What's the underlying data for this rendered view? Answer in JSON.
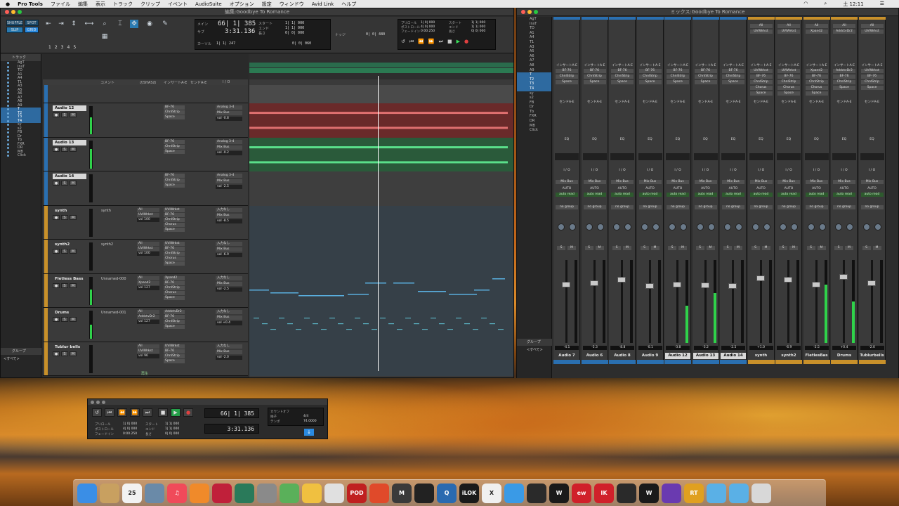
{
  "menubar": {
    "items": [
      "Pro Tools",
      "ファイル",
      "編集",
      "表示",
      "トラック",
      "クリップ",
      "イベント",
      "AudioSuite",
      "オプション",
      "設定",
      "ウィンドウ",
      "Avid Link",
      "ヘルプ"
    ],
    "clock": "土 12:11"
  },
  "edit_window": {
    "title": "編集:Goodbye To Romance",
    "modes": [
      "SHUFFLE",
      "SPOT",
      "SLIP",
      "GRID"
    ],
    "zoom_numbers": [
      "1",
      "2",
      "3",
      "4",
      "5"
    ],
    "counter": {
      "main_label": "メイン",
      "sub_label": "サブ",
      "main_value": "66| 1| 385",
      "sub_value": "3:31.136",
      "cursor_label": "カーソル",
      "cursor_value": "1| 1| 247",
      "start_label": "スタート",
      "end_label": "エンド",
      "length_label": "長さ",
      "start_value": "1| 1| 000",
      "end_value": "1| 1| 000",
      "length_value": "0| 0| 000",
      "nudge_label": "ナッジ",
      "nudge_value": "0| 0| 480",
      "grid_value": "0| 0| 060"
    },
    "mini_transport": {
      "preroll_label": "プリロール",
      "postroll_label": "ポストロール",
      "fadein_label": "フェードイン",
      "preroll": "1| 0| 000",
      "postroll": "4| 0| 000",
      "fadein": "0:00.250",
      "start_label": "スタート",
      "end_label": "エンド",
      "length_label": "長さ",
      "start": "1| 1| 000",
      "end": "1| 1| 000",
      "length": "0| 0| 000"
    },
    "tracklist_header": "トラック",
    "tracklist": [
      "AgT",
      "InsT",
      "TD",
      "A1",
      "A4",
      "T1",
      "A3",
      "A5",
      "A6",
      "A7",
      "A8",
      "A9",
      "T",
      "T2",
      "T3",
      "T4",
      "sy",
      "s2",
      "FB",
      "Dr",
      "Tb",
      "FXR",
      "DR",
      "MB",
      "Click"
    ],
    "group_header": "グループ",
    "group_item": "<すべて>",
    "column_headers": [
      "コメント",
      "のSHASの",
      "インサートA-E",
      "センドA-E",
      "I / O"
    ],
    "tracks": [
      {
        "name": "Audio 12",
        "comment": "",
        "inserts": [
          "BF-76",
          "ChnlStrip",
          "Space"
        ],
        "io": [
          "Analog 3-4",
          "Mix Bus",
          "vol -0.8"
        ],
        "meter": 0.6
      },
      {
        "name": "Audio 13",
        "comment": "",
        "inserts": [
          "BF-76",
          "ChnlStrip",
          "Space"
        ],
        "io": [
          "Analog 3-4",
          "Mix Bus",
          "vol -0.2"
        ],
        "meter": 0.7
      },
      {
        "name": "Audio 14",
        "comment": "",
        "inserts": [
          "BF-76",
          "ChnlStrip",
          "Space"
        ],
        "io": [
          "Analog 3-4",
          "Mix Bus",
          "vol -2.5"
        ],
        "meter": 0.0
      },
      {
        "name": "synth",
        "comment": "synth",
        "inserts": [
          "UVIWrkst",
          "BF-76",
          "ChnlStrip",
          "Chorus",
          "Space"
        ],
        "io": [
          "入力なし",
          "Mix Bus",
          "vol -8.5"
        ],
        "meter": 0.0,
        "vol": "vol 100"
      },
      {
        "name": "synth2",
        "comment": "synth2",
        "inserts": [
          "UVIWrkst",
          "BF-76",
          "ChnlStrip",
          "Chorus",
          "Space"
        ],
        "io": [
          "入力なし",
          "Mix Bus",
          "vol -6.9"
        ],
        "meter": 0.0,
        "vol": "vol 100"
      },
      {
        "name": "Fletless Bass",
        "comment": "Unnamed-000",
        "inserts": [
          "Xpand2",
          "BF-76",
          "ChnlStrip",
          "Chorus",
          "Space"
        ],
        "io": [
          "入力なし",
          "Mix Bus",
          "vol -2.5"
        ],
        "meter": 0.55,
        "vol": "vol 127"
      },
      {
        "name": "Drums",
        "comment": "Unnamed-001",
        "inserts": [
          "AddctvDr2",
          "BF-76",
          "ChnlStrip",
          "Space"
        ],
        "io": [
          "入力なし",
          "Mix Bus",
          "vol +0.4"
        ],
        "meter": 0.5,
        "vol": "vol 127"
      },
      {
        "name": "Tublur bells",
        "comment": "",
        "inserts": [
          "UVIWrkst",
          "BF-76",
          "ChnlStrip",
          "Space"
        ],
        "io": [
          "入力なし",
          "Mix Bus",
          "vol -2.0"
        ],
        "meter": 0.0,
        "vol": "vol 96"
      }
    ],
    "status_text": "再生"
  },
  "mix_window": {
    "title": "ミックス:Goodbye To Romance",
    "group_header": "グループ",
    "group_item": "<すべて>",
    "strips": [
      {
        "name": "Audio 7",
        "db": "-4.1",
        "color": "#2a6fb0",
        "inserts": [
          "BF-76",
          "ChnlStrip",
          "Space"
        ],
        "meter": 0.0,
        "fader": 0.72,
        "highlight": false
      },
      {
        "name": "Audio 6",
        "db": "-5.3",
        "color": "#2a6fb0",
        "inserts": [
          "BF-76",
          "ChnlStrip",
          "Space"
        ],
        "meter": 0.0,
        "fader": 0.74,
        "highlight": false
      },
      {
        "name": "Audio 8",
        "db": "-8.8",
        "color": "#2a6fb0",
        "inserts": [
          "BF-76",
          "ChnlStrip",
          "Space"
        ],
        "meter": 0.0,
        "fader": 0.78,
        "highlight": false
      },
      {
        "name": "Audio 9",
        "db": "-0.1",
        "color": "#2a6fb0",
        "inserts": [
          "BF-76",
          "ChnlStrip",
          "Space"
        ],
        "meter": 0.0,
        "fader": 0.7,
        "highlight": false
      },
      {
        "name": "Audio 12",
        "db": "-3.8",
        "color": "#2a6fb0",
        "inserts": [
          "BF-76",
          "ChnlStrip",
          "Space"
        ],
        "meter": 0.45,
        "fader": 0.72,
        "highlight": true
      },
      {
        "name": "Audio 13",
        "db": "-3.2",
        "color": "#2a6fb0",
        "inserts": [
          "BF-76",
          "ChnlStrip",
          "Space"
        ],
        "meter": 0.6,
        "fader": 0.71,
        "highlight": true
      },
      {
        "name": "Audio 14",
        "db": "-2.5",
        "color": "#2a6fb0",
        "inserts": [
          "BF-76",
          "ChnlStrip",
          "Space"
        ],
        "meter": 0.0,
        "fader": 0.7,
        "highlight": true
      },
      {
        "name": "synth",
        "db": "+1.0",
        "color": "#c8902a",
        "inserts": [
          "UVIWrkst",
          "BF-76",
          "ChnlStrip",
          "Chorus",
          "Space"
        ],
        "meter": 0.0,
        "fader": 0.8,
        "highlight": false
      },
      {
        "name": "synth2",
        "db": "-6.9",
        "color": "#c8902a",
        "inserts": [
          "UVIWrkst",
          "BF-76",
          "ChnlStrip",
          "Chorus",
          "Space"
        ],
        "meter": 0.0,
        "fader": 0.78,
        "highlight": false
      },
      {
        "name": "FletlesBas",
        "db": "-2.5",
        "color": "#c8902a",
        "inserts": [
          "Xpand2",
          "BF-76",
          "ChnlStrip",
          "Chorus",
          "Space"
        ],
        "meter": 0.7,
        "fader": 0.72,
        "highlight": false
      },
      {
        "name": "Drums",
        "db": "+0.4",
        "color": "#c8902a",
        "inserts": [
          "AddctvDr2",
          "BF-76",
          "ChnlStrip",
          "Space"
        ],
        "meter": 0.5,
        "fader": 0.82,
        "highlight": false
      },
      {
        "name": "Tublurbells",
        "db": "-2.0",
        "color": "#c8902a",
        "inserts": [
          "UVIWrkst",
          "BF-76",
          "ChnlStrip",
          "Space"
        ],
        "meter": 0.0,
        "fader": 0.74,
        "highlight": false
      }
    ],
    "labels": {
      "insert": "インサートA-E",
      "send": "センドA-E",
      "eq": "EQ",
      "io": "I / O",
      "auto": "AUTO",
      "auto_mode": "auto read",
      "group": "no group",
      "output": "Mix Bus"
    }
  },
  "transport_window": {
    "counter_main": "66| 1| 385",
    "counter_sub": "3:31.136",
    "preroll_label": "プリロール",
    "postroll_label": "ポストロール",
    "fadein_label": "フェードイン",
    "preroll": "1| 0| 000",
    "postroll": "4| 0| 000",
    "fadein": "0:00.250",
    "start_label": "スタート",
    "end_label": "エンド",
    "length_label": "長さ",
    "start": "1| 1| 000",
    "end": "1| 1| 000",
    "length": "0| 0| 000",
    "meter_label": "拍子",
    "tempo_label": "テンポ",
    "meter": "4/4",
    "tempo": "74.0000",
    "count_label": "カウントオフ"
  },
  "dock": {
    "items": [
      {
        "name": "finder",
        "label": "",
        "color": "#3a8ee6"
      },
      {
        "name": "notes",
        "label": "",
        "color": "#c8a060"
      },
      {
        "name": "calendar",
        "label": "25",
        "color": "#f2f2f2"
      },
      {
        "name": "preview",
        "label": "",
        "color": "#6a8aa8"
      },
      {
        "name": "music",
        "label": "♫",
        "color": "#f04a5a"
      },
      {
        "name": "books",
        "label": "",
        "color": "#f08a2a"
      },
      {
        "name": "photo-booth",
        "label": "",
        "color": "#c0203a"
      },
      {
        "name": "time-machine",
        "label": "",
        "color": "#2a7a5a"
      },
      {
        "name": "system-prefs",
        "label": "",
        "color": "#8a8a8a"
      },
      {
        "name": "maps",
        "label": "",
        "color": "#5ab05a"
      },
      {
        "name": "photos",
        "label": "",
        "color": "#f0c040"
      },
      {
        "name": "midi-util",
        "label": "",
        "color": "#e0e0e0"
      },
      {
        "name": "pod-farm",
        "label": "POD",
        "color": "#c02020"
      },
      {
        "name": "app-mascot",
        "label": "",
        "color": "#e04a2a"
      },
      {
        "name": "mbox",
        "label": "M",
        "color": "#3a3a3a"
      },
      {
        "name": "piano",
        "label": "",
        "color": "#222222"
      },
      {
        "name": "quicktime",
        "label": "Q",
        "color": "#2a6ab0"
      },
      {
        "name": "ilok",
        "label": "iLOK",
        "color": "#1a1a1a"
      },
      {
        "name": "x-app",
        "label": "X",
        "color": "#f0f0f0"
      },
      {
        "name": "safari",
        "label": "",
        "color": "#3a9ae6"
      },
      {
        "name": "glasses-app",
        "label": "",
        "color": "#2a2a2a"
      },
      {
        "name": "waves-app",
        "label": "W",
        "color": "#1a1a1a"
      },
      {
        "name": "ew-app",
        "label": "ew",
        "color": "#d0202a"
      },
      {
        "name": "ik-app",
        "label": "IK",
        "color": "#d0202a"
      },
      {
        "name": "link-app",
        "label": "",
        "color": "#2a2a2a"
      },
      {
        "name": "waves-central",
        "label": "W",
        "color": "#1a1a1a"
      },
      {
        "name": "avid-app",
        "label": "",
        "color": "#6a3ab0"
      },
      {
        "name": "shield-app",
        "label": "RT",
        "color": "#e0a020"
      },
      {
        "name": "applications",
        "label": "",
        "color": "#5ab0e6"
      },
      {
        "name": "downloads",
        "label": "",
        "color": "#5ab0e6"
      },
      {
        "name": "trash",
        "label": "",
        "color": "#d8d8d8"
      }
    ]
  }
}
